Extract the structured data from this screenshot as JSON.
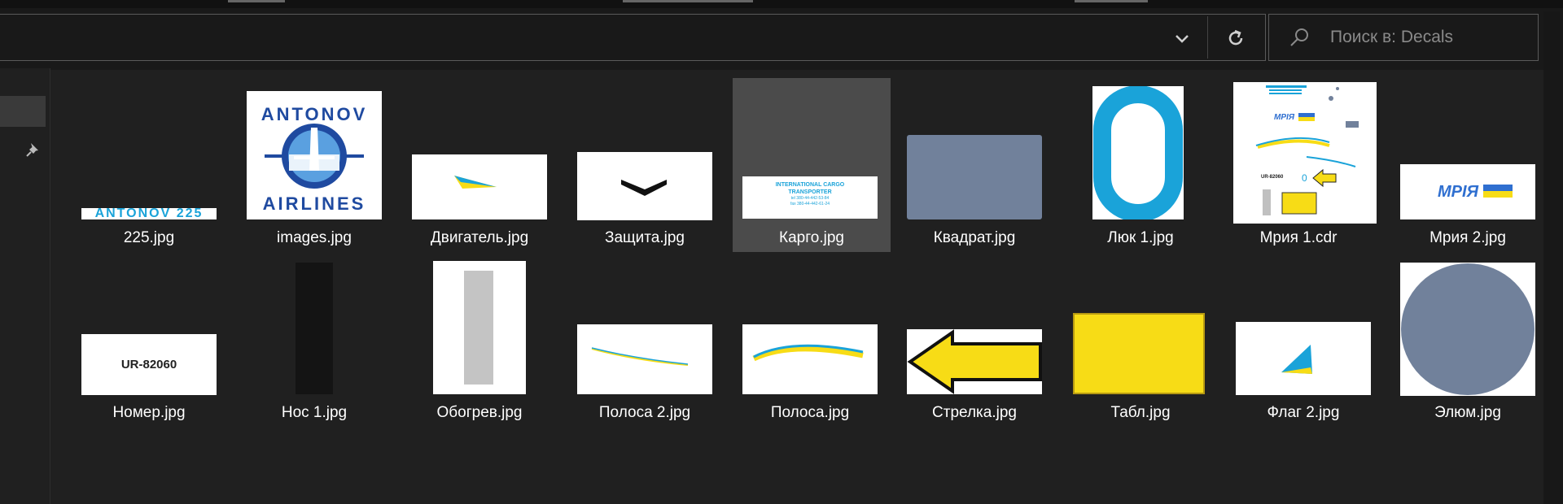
{
  "search": {
    "placeholder": "Поиск в: Decals"
  },
  "files": [
    {
      "name": "225.jpg"
    },
    {
      "name": "images.jpg"
    },
    {
      "name": "Двигатель.jpg"
    },
    {
      "name": "Защита.jpg"
    },
    {
      "name": "Карго.jpg",
      "selected": true
    },
    {
      "name": "Квадрат.jpg"
    },
    {
      "name": "Люк 1.jpg"
    },
    {
      "name": "Мрия 1.cdr"
    },
    {
      "name": "Мрия 2.jpg"
    },
    {
      "name": "Номер.jpg"
    },
    {
      "name": "Нос 1.jpg"
    },
    {
      "name": "Обогрев.jpg"
    },
    {
      "name": "Полоса 2.jpg"
    },
    {
      "name": "Полоса.jpg"
    },
    {
      "name": "Стрелка.jpg"
    },
    {
      "name": "Табл.jpg"
    },
    {
      "name": "Флаг 2.jpg"
    },
    {
      "name": "Элюм.jpg"
    }
  ],
  "thumb_text": {
    "antonov_225": "ANTONOV 225",
    "antonov_logo_top": "ANTONOV",
    "antonov_logo_bottom": "AIRLINES",
    "cargo_line1": "INTERNATIONAL CARGO",
    "cargo_line2": "TRANSPORTER",
    "cargo_line3": "tel 380-44-442-53-84",
    "cargo_line4": "fax 380-44-442-61-24",
    "mriya": "МРІЯ",
    "mriya_small": "МРІЯ",
    "reg_number": "UR-82060",
    "reg_small": "UR-82060",
    "hatch_small": "0"
  },
  "colors": {
    "accent_blue": "#1aa3d9",
    "ukraine_blue": "#2f6fd0",
    "ukraine_yellow": "#f7dc16",
    "slate": "#71819b",
    "antonov_blue": "#1f4aa0"
  }
}
